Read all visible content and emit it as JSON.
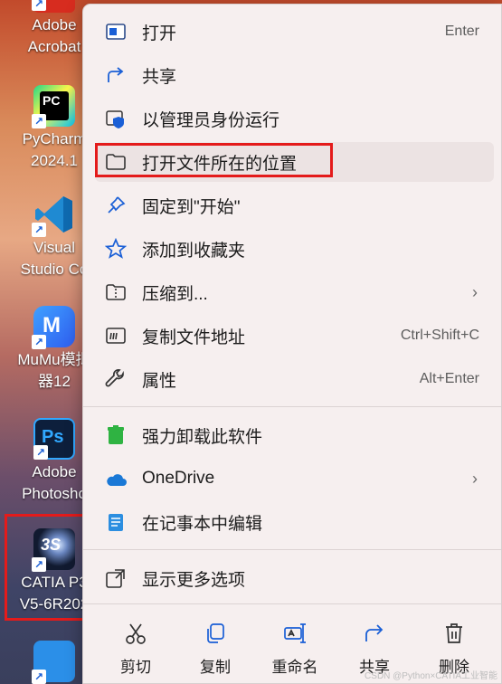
{
  "desktop": {
    "icons": [
      {
        "name": "adobe-acrobat",
        "lines": [
          "Adobe",
          "Acrobat"
        ],
        "color": "#d72c1f"
      },
      {
        "name": "pycharm",
        "lines": [
          "PyCharm",
          "2024.1"
        ],
        "color": "#1b1b1b"
      },
      {
        "name": "vscode",
        "lines": [
          "Visual",
          "Studio Co"
        ],
        "color": "#1f8ad2"
      },
      {
        "name": "mumu",
        "lines": [
          "MuMu模拟",
          "器12"
        ],
        "color": "#3a7af0"
      },
      {
        "name": "photoshop",
        "lines": [
          "Adobe",
          "Photosho"
        ],
        "color": "#0d1f3c"
      },
      {
        "name": "catia",
        "lines": [
          "CATIA P3",
          "V5-6R202"
        ],
        "color": "#0a0f1e"
      }
    ]
  },
  "menu": {
    "items": [
      {
        "label": "打开",
        "shortcut": "Enter",
        "icon": "open-app-icon"
      },
      {
        "label": "共享",
        "shortcut": "",
        "icon": "share-icon"
      },
      {
        "label": "以管理员身份运行",
        "shortcut": "",
        "icon": "shield-icon"
      },
      {
        "label": "打开文件所在的位置",
        "shortcut": "",
        "icon": "folder-icon"
      },
      {
        "label": "固定到\"开始\"",
        "shortcut": "",
        "icon": "pin-icon"
      },
      {
        "label": "添加到收藏夹",
        "shortcut": "",
        "icon": "star-icon"
      },
      {
        "label": "压缩到...",
        "shortcut": "",
        "icon": "zip-folder-icon"
      },
      {
        "label": "复制文件地址",
        "shortcut": "Ctrl+Shift+C",
        "icon": "copy-path-icon"
      },
      {
        "label": "属性",
        "shortcut": "Alt+Enter",
        "icon": "wrench-icon"
      },
      {
        "label": "强力卸载此软件",
        "shortcut": "",
        "icon": "trash-green-icon"
      },
      {
        "label": "OneDrive",
        "shortcut": "",
        "icon": "cloud-icon"
      },
      {
        "label": "在记事本中编辑",
        "shortcut": "",
        "icon": "notepad-icon"
      },
      {
        "label": "显示更多选项",
        "shortcut": "",
        "icon": "more-options-icon"
      }
    ],
    "bottom_actions": [
      {
        "label": "剪切",
        "icon": "scissors-icon"
      },
      {
        "label": "复制",
        "icon": "copy-icon"
      },
      {
        "label": "重命名",
        "icon": "rename-icon"
      },
      {
        "label": "共享",
        "icon": "share-icon"
      },
      {
        "label": "删除",
        "icon": "trash-icon"
      }
    ]
  },
  "colors": {
    "highlight_box": "#e41b1b",
    "accent": "#1a5fd6"
  },
  "watermark": "CSDN @Python×CATIA工业智能"
}
